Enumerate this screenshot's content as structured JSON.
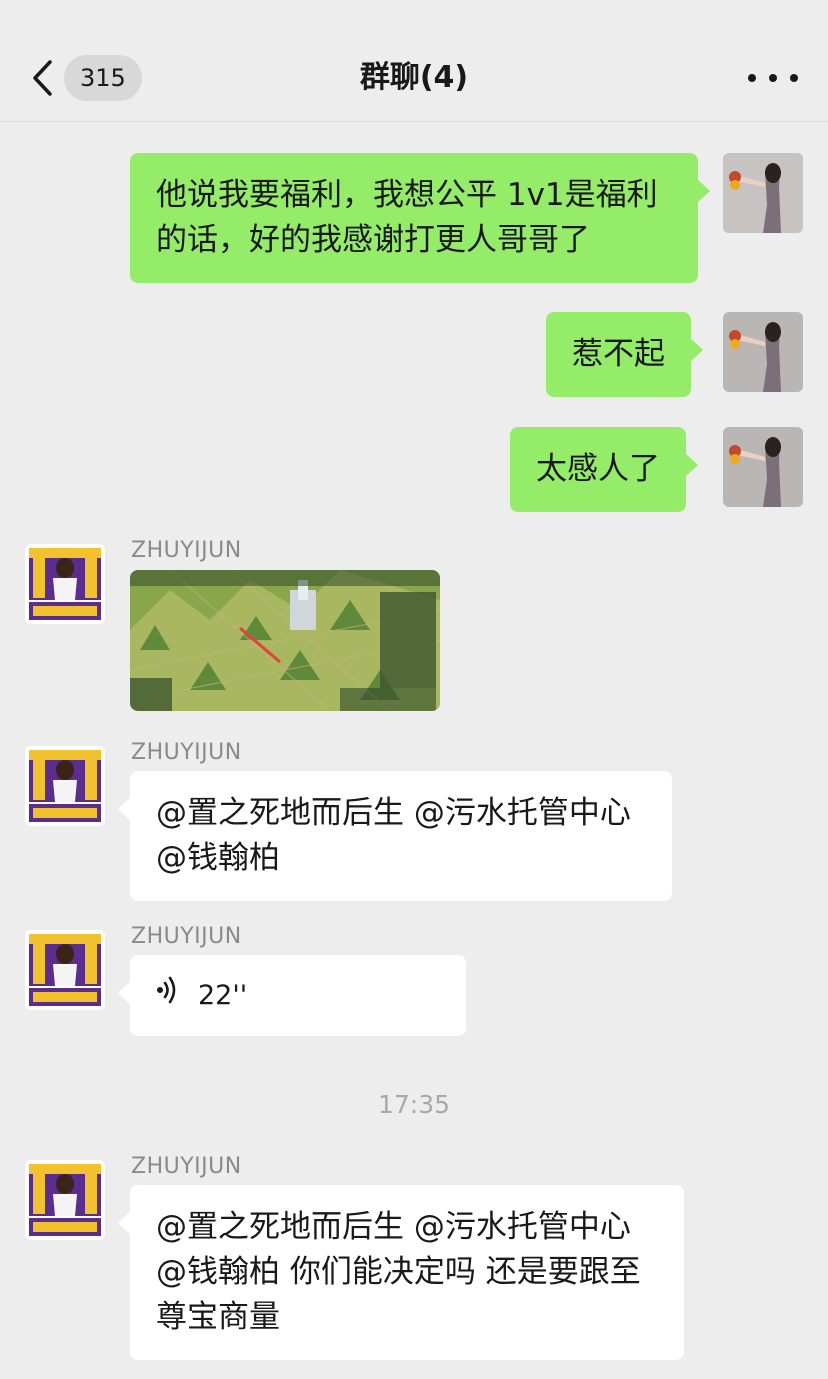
{
  "header": {
    "unread_count": "315",
    "title": "群聊(4)"
  },
  "messages": [
    {
      "side": "me",
      "text": "他说我要福利，我想公平 1v1是福利的话，好的我感谢打更人哥哥了"
    },
    {
      "side": "me",
      "text": "惹不起"
    },
    {
      "side": "me",
      "text": "太感人了"
    },
    {
      "side": "other",
      "sender": "ZHUYIJUN",
      "type": "image",
      "image_desc": "game-map-screenshot"
    },
    {
      "side": "other",
      "sender": "ZHUYIJUN",
      "text": "@置之死地而后生 @污水托管中心@钱翰柏"
    },
    {
      "side": "other",
      "sender": "ZHUYIJUN",
      "type": "voice",
      "duration": "22''"
    },
    {
      "side": "other",
      "sender": "ZHUYIJUN",
      "text": "@置之死地而后生 @污水托管中心@钱翰柏 你们能决定吗 还是要跟至尊宝商量"
    }
  ],
  "timestamp": "17:35",
  "icons": {
    "back": "chevron-left-icon",
    "more": "more-dots-icon",
    "voice": "voice-wave-icon"
  },
  "colors": {
    "my_bubble": "#95ec69",
    "other_bubble": "#ffffff",
    "background": "#ededed",
    "avatar_brand": "#5b2d8e",
    "avatar_gold": "#f2c12e"
  }
}
